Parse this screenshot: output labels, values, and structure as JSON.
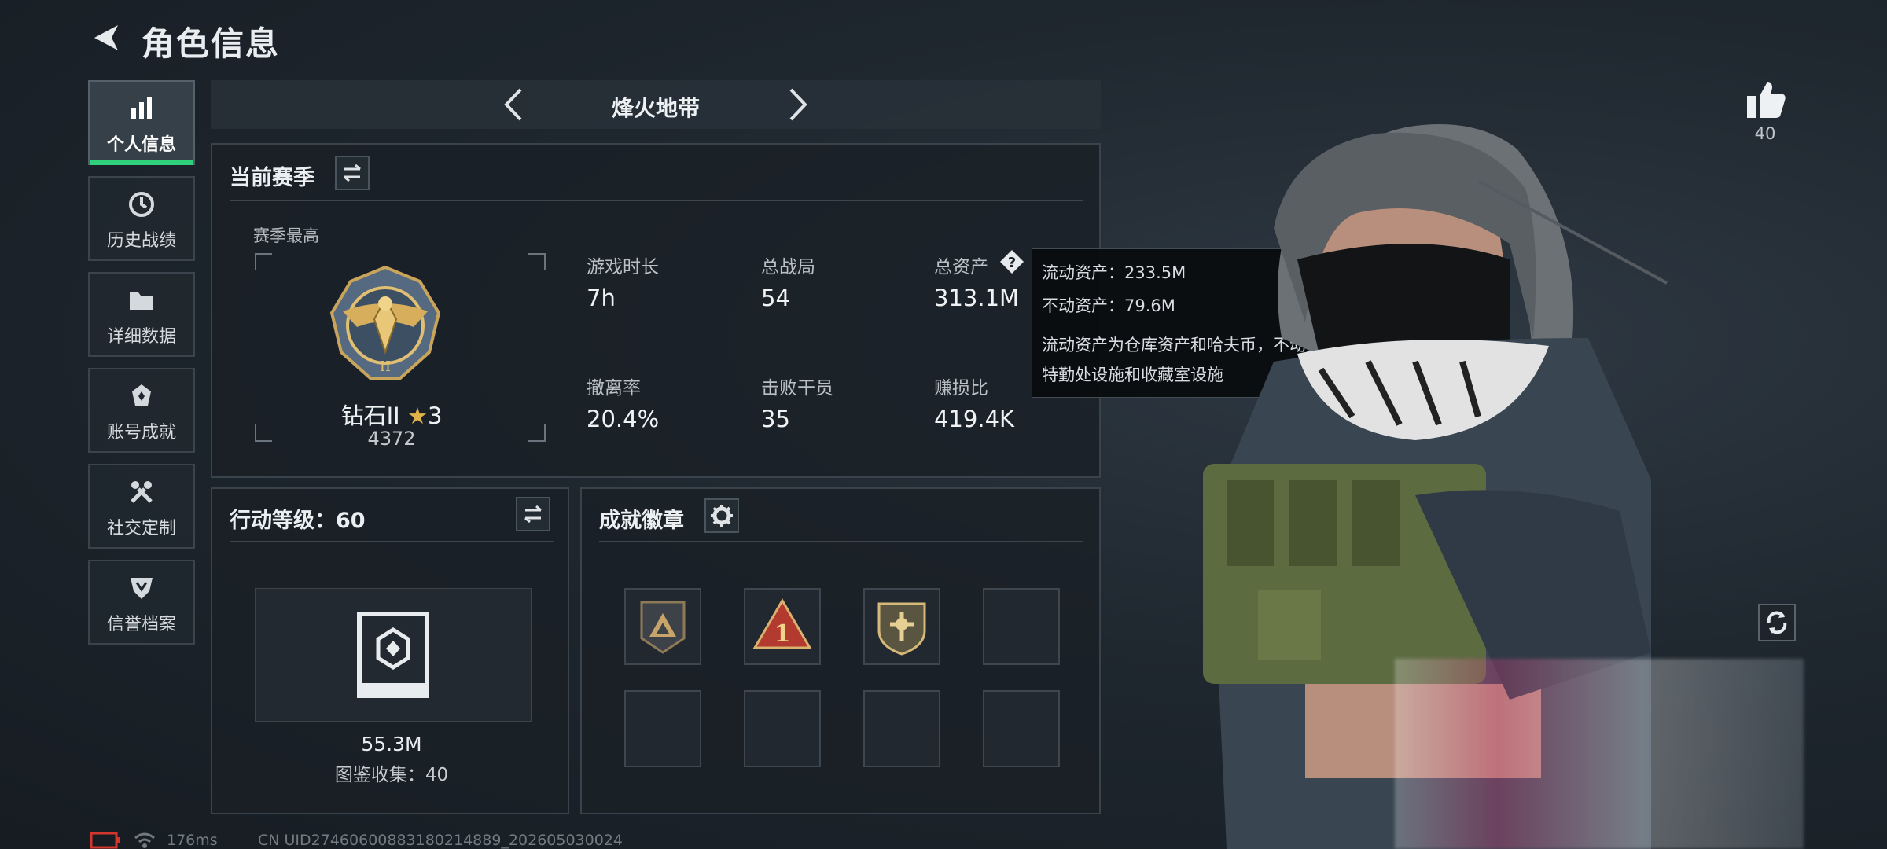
{
  "header": {
    "title": "角色信息"
  },
  "sidebar": {
    "items": [
      {
        "label": "个人信息",
        "icon": "bar-chart-icon",
        "active": true
      },
      {
        "label": "历史战绩",
        "icon": "clock-icon"
      },
      {
        "label": "详细数据",
        "icon": "folder-icon"
      },
      {
        "label": "账号成就",
        "icon": "achievement-icon"
      },
      {
        "label": "社交定制",
        "icon": "tools-icon"
      },
      {
        "label": "信誉档案",
        "icon": "shield-icon"
      }
    ]
  },
  "map_selector": {
    "name": "烽火地带"
  },
  "season": {
    "title": "当前赛季",
    "best_label": "赛季最高",
    "rank_name": "钻石II",
    "rank_stars": "3",
    "rank_points": "4372",
    "stats": [
      {
        "label": "游戏时长",
        "value": "7h"
      },
      {
        "label": "总战局",
        "value": "54"
      },
      {
        "label": "总资产",
        "value": "313.1M"
      },
      {
        "label": "撤离率",
        "value": "20.4%"
      },
      {
        "label": "击败干员",
        "value": "35"
      },
      {
        "label": "赚损比",
        "value": "419.4K"
      }
    ]
  },
  "asset_tooltip": {
    "line1": "流动资产：233.5M",
    "line2": "不动资产：79.6M",
    "desc_line1": "流动资产为仓库资产和哈夫币，不动资产为",
    "desc_line2": "特勤处设施和收藏室设施"
  },
  "action_level": {
    "title": "行动等级：60",
    "value": "55.3M",
    "collection": "图鉴收集：40"
  },
  "achievements": {
    "title": "成就徽章"
  },
  "likes": {
    "count": "40"
  },
  "footer": {
    "ping": "176ms",
    "uid": "CN UID2746060088318021488​9_202605030024"
  },
  "colors": {
    "accent": "#2fd17a",
    "rank_star": "#e2b24a"
  }
}
